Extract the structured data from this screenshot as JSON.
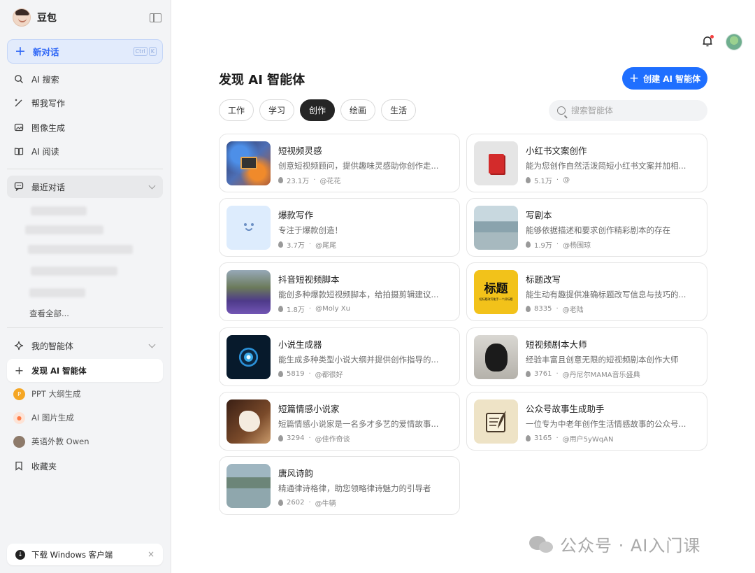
{
  "brand": {
    "name": "豆包"
  },
  "sidebar": {
    "new_chat": {
      "label": "新对话",
      "shortcut": [
        "Ctrl",
        "K"
      ]
    },
    "nav": [
      {
        "label": "AI 搜索",
        "icon": "search-spark-icon"
      },
      {
        "label": "帮我写作",
        "icon": "pen-spark-icon"
      },
      {
        "label": "图像生成",
        "icon": "image-icon"
      },
      {
        "label": "AI 阅读",
        "icon": "book-open-icon"
      }
    ],
    "recent": {
      "label": "最近对话",
      "view_all": "查看全部..."
    },
    "my_agents": {
      "label": "我的智能体"
    },
    "discover": {
      "label": "发现 AI 智能体"
    },
    "agents": [
      {
        "label": "PPT 大纲生成",
        "color": "#f5a623"
      },
      {
        "label": "AI 图片生成",
        "color": "#ff7a45"
      },
      {
        "label": "英语外教 Owen",
        "color": "#8d7a6a"
      }
    ],
    "favorites": {
      "label": "收藏夹"
    },
    "download": {
      "label": "下载 Windows 客户端"
    }
  },
  "header": {
    "title": "发现 AI 智能体",
    "create_label": "创建 AI 智能体"
  },
  "tabs": [
    {
      "label": "工作",
      "active": false
    },
    {
      "label": "学习",
      "active": false
    },
    {
      "label": "创作",
      "active": true
    },
    {
      "label": "绘画",
      "active": false
    },
    {
      "label": "生活",
      "active": false
    }
  ],
  "search": {
    "placeholder": "搜索智能体"
  },
  "cards": [
    {
      "title": "短视频灵感",
      "desc": "创意短视频顾问，提供趣味灵感助你创作走...",
      "count": "23.1万",
      "author": "@花花"
    },
    {
      "title": "小红书文案创作",
      "desc": "能为您创作自然活泼简短小红书文案并加相...",
      "count": "5.1万",
      "author": "@"
    },
    {
      "title": "爆款写作",
      "desc": "专注于爆款创造！",
      "count": "3.7万",
      "author": "@尾尾"
    },
    {
      "title": "写剧本",
      "desc": "能够依据描述和要求创作精彩剧本的存在",
      "count": "1.9万",
      "author": "@杨围琼"
    },
    {
      "title": "抖音短视频脚本",
      "desc": "能创多种爆款短视频脚本，给拍摄剪辑建议...",
      "count": "1.8万",
      "author": "@Moly Xu"
    },
    {
      "title": "标题改写",
      "desc": "能生动有趣提供准确标题改写信息与技巧的...",
      "count": "8335",
      "author": "@老陆",
      "thumb_text": "标题",
      "thumb_small": "短标题改写能手一个好标题"
    },
    {
      "title": "小说生成器",
      "desc": "能生成多种类型小说大纲并提供创作指导的...",
      "count": "5819",
      "author": "@都很好"
    },
    {
      "title": "短视频剧本大师",
      "desc": "经验丰富且创意无限的短视频剧本创作大师",
      "count": "3761",
      "author": "@丹尼尔MAMA音乐盛典"
    },
    {
      "title": "短篇情感小说家",
      "desc": "短篇情感小说家是一名多才多艺的爱情故事...",
      "count": "3294",
      "author": "@佳作奇谈"
    },
    {
      "title": "公众号故事生成助手",
      "desc": "一位专为中老年创作生活情感故事的公众号...",
      "count": "3165",
      "author": "@用户5yWqAN"
    },
    {
      "title": "唐风诗韵",
      "desc": "精通律诗格律，助您领略律诗魅力的引导者",
      "count": "2602",
      "author": "@牛辆"
    }
  ],
  "meta_separator": "·",
  "watermark": {
    "text": "公众号 · AI入门课"
  }
}
